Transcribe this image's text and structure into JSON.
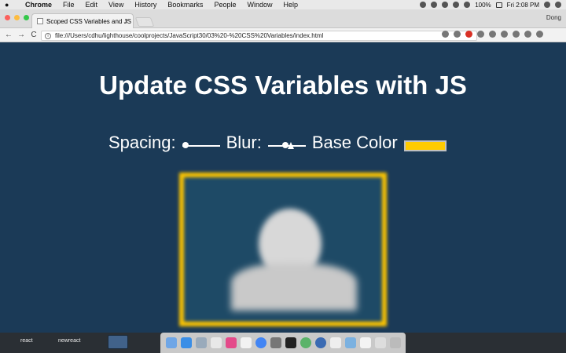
{
  "menubar": {
    "apple_icon": "apple-icon",
    "app_name": "Chrome",
    "items": [
      "File",
      "Edit",
      "View",
      "History",
      "Bookmarks",
      "People",
      "Window",
      "Help"
    ],
    "battery": "100%",
    "clock": "Fri 2:08 PM"
  },
  "browser": {
    "tab_title": "Scoped CSS Variables and JS",
    "tab_close": "×",
    "user": "Dong",
    "nav": {
      "back": "←",
      "forward": "→",
      "reload": "C"
    },
    "url": "file:///Users/cdhu/lighthouse/coolprojects/JavaScript30/03%20-%20CSS%20Variables/index.html"
  },
  "page": {
    "title": "Update CSS Variables with JS",
    "controls": [
      {
        "label": "Spacing:",
        "value": 0
      },
      {
        "label": "Blur:",
        "value": 0.45
      },
      {
        "label": "Base Color",
        "value": "#ffcb00"
      }
    ],
    "image": {
      "head_text": "",
      "foot_text": "",
      "border_color": "#ffc600"
    }
  },
  "dock": {
    "desktop_labels": [
      "react",
      "newreact"
    ]
  },
  "colors": {
    "background": "#1b3a57",
    "accent": "#ffcb00"
  }
}
